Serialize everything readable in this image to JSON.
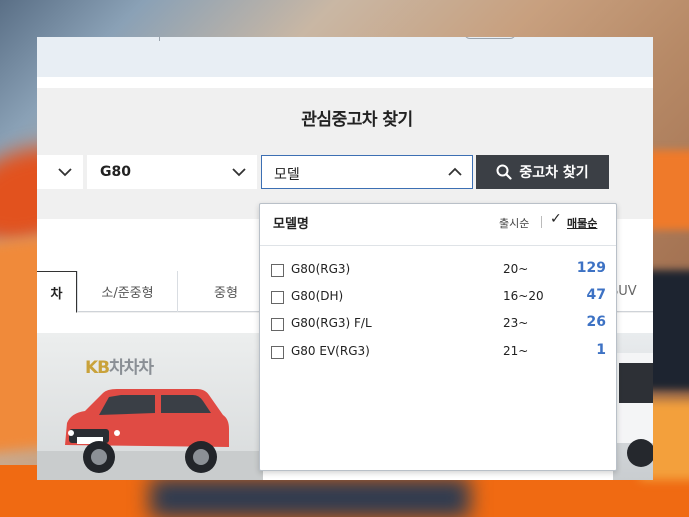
{
  "page": {
    "section_title": "관심중고차 찾기"
  },
  "search": {
    "model_value": "G80",
    "detail_value": "모델",
    "button_label": "중고차 찾기"
  },
  "tabs": [
    {
      "label": "차",
      "active": true
    },
    {
      "label": "소/준중형",
      "active": false
    },
    {
      "label": "중형",
      "active": false
    },
    {
      "label": "SUV",
      "active": false
    }
  ],
  "card": {
    "logo_kb": "KB",
    "logo_brand": "차차차"
  },
  "dropdown": {
    "title": "모델명",
    "sort_release": "출시순",
    "sort_listing": "매물순",
    "selected_sort": "매물순",
    "items": [
      {
        "name": "G80(RG3)",
        "year": "20~",
        "count": "129"
      },
      {
        "name": "G80(DH)",
        "year": "16~20",
        "count": "47"
      },
      {
        "name": "G80(RG3) F/L",
        "year": "23~",
        "count": "26"
      },
      {
        "name": "G80 EV(RG3)",
        "year": "21~",
        "count": "1"
      }
    ]
  },
  "colors": {
    "count_blue": "#3d72c4",
    "button_dark": "#3b3f45",
    "focus_border": "#3c6fb3"
  }
}
